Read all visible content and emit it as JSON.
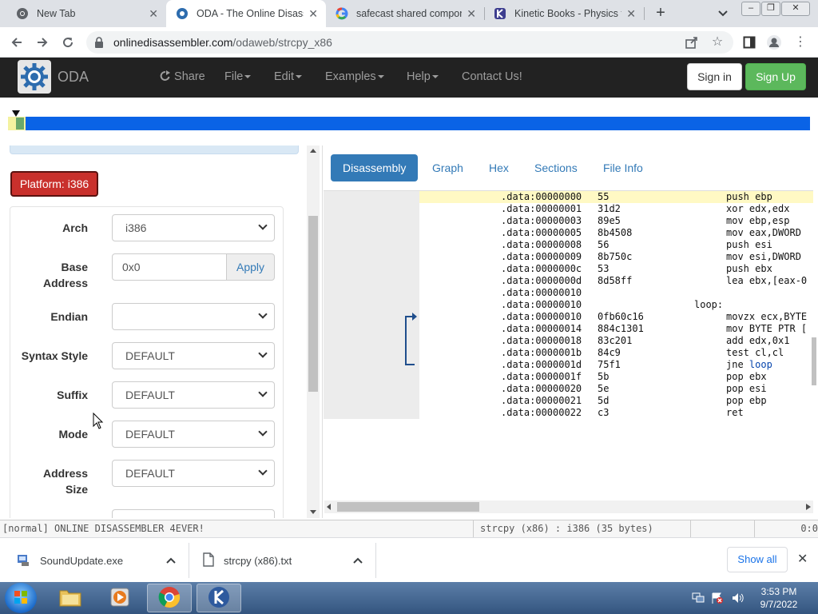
{
  "browser": {
    "tabs": [
      {
        "title": "New Tab",
        "icon": "chrome-icon"
      },
      {
        "title": "ODA - The Online Disasse",
        "icon": "oda-gear-icon"
      },
      {
        "title": "safecast shared compone",
        "icon": "google-icon"
      },
      {
        "title": "Kinetic Books - Physics fo",
        "icon": "kinetic-books-icon"
      }
    ],
    "url_host": "onlinedisassembler.com",
    "url_path": "/odaweb/strcpy_x86"
  },
  "oda": {
    "brand": "ODA",
    "menu": [
      {
        "label": "Share",
        "has_caret": false
      },
      {
        "label": "File",
        "has_caret": true
      },
      {
        "label": "Edit",
        "has_caret": true
      },
      {
        "label": "Examples",
        "has_caret": true
      },
      {
        "label": "Help",
        "has_caret": true
      },
      {
        "label": "Contact Us!",
        "has_caret": false
      }
    ],
    "sign_in": "Sign in",
    "sign_up": "Sign Up",
    "colors": {
      "navbar": "#222222",
      "primary": "#337ab7",
      "danger": "#c9302c",
      "success": "#5cb85c"
    }
  },
  "platform": {
    "label": "Platform: i386"
  },
  "form": {
    "arch": {
      "label": "Arch",
      "value": "i386"
    },
    "base_address": {
      "label_line1": "Base",
      "label_line2": "Address",
      "value": "0x0",
      "apply": "Apply"
    },
    "endian": {
      "label": "Endian",
      "value": ""
    },
    "syntax_style": {
      "label": "Syntax Style",
      "value": "DEFAULT"
    },
    "suffix": {
      "label": "Suffix",
      "value": "DEFAULT"
    },
    "mode": {
      "label": "Mode",
      "value": "DEFAULT"
    },
    "address_size": {
      "label_line1": "Address",
      "label_line2": "Size",
      "value": "DEFAULT"
    }
  },
  "right_tabs": [
    {
      "label": "Disassembly",
      "active": true
    },
    {
      "label": "Graph",
      "active": false
    },
    {
      "label": "Hex",
      "active": false
    },
    {
      "label": "Sections",
      "active": false
    },
    {
      "label": "File Info",
      "active": false
    }
  ],
  "disassembly": [
    {
      "addr": ".data:00000000",
      "bytes": "55",
      "ins": "push ebp"
    },
    {
      "addr": ".data:00000001",
      "bytes": "31d2",
      "ins": "xor edx,edx"
    },
    {
      "addr": ".data:00000003",
      "bytes": "89e5",
      "ins": "mov ebp,esp"
    },
    {
      "addr": ".data:00000005",
      "bytes": "8b4508",
      "ins": "mov eax,DWORD"
    },
    {
      "addr": ".data:00000008",
      "bytes": "56",
      "ins": "push esi"
    },
    {
      "addr": ".data:00000009",
      "bytes": "8b750c",
      "ins": "mov esi,DWORD"
    },
    {
      "addr": ".data:0000000c",
      "bytes": "53",
      "ins": "push ebx"
    },
    {
      "addr": ".data:0000000d",
      "bytes": "8d58ff",
      "ins": "lea ebx,[eax-0"
    },
    {
      "addr": ".data:00000010",
      "bytes": "",
      "ins": ""
    },
    {
      "addr": ".data:00000010",
      "bytes": "",
      "ins": "",
      "label": "loop:"
    },
    {
      "addr": ".data:00000010",
      "bytes": "0fb60c16",
      "ins": "movzx ecx,BYTE"
    },
    {
      "addr": ".data:00000014",
      "bytes": "884c1301",
      "ins": "mov BYTE PTR ["
    },
    {
      "addr": ".data:00000018",
      "bytes": "83c201",
      "ins": "add edx,0x1"
    },
    {
      "addr": ".data:0000001b",
      "bytes": "84c9",
      "ins": "test cl,cl"
    },
    {
      "addr": ".data:0000001d",
      "bytes": "75f1",
      "ins": "jne ",
      "target": "loop"
    },
    {
      "addr": ".data:0000001f",
      "bytes": "5b",
      "ins": "pop ebx"
    },
    {
      "addr": ".data:00000020",
      "bytes": "5e",
      "ins": "pop esi"
    },
    {
      "addr": ".data:00000021",
      "bytes": "5d",
      "ins": "pop ebp"
    },
    {
      "addr": ".data:00000022",
      "bytes": "c3",
      "ins": "ret"
    }
  ],
  "status": {
    "message": "[normal] ONLINE DISASSEMBLER 4EVER!",
    "file_info": "strcpy (x86) : i386 (35 bytes)",
    "position": "0:0"
  },
  "downloads": [
    {
      "name": "SoundUpdate.exe",
      "icon": "installer-icon"
    },
    {
      "name": "strcpy (x86).txt",
      "icon": "text-file-icon"
    }
  ],
  "show_all": "Show all",
  "taskbar": {
    "time": "3:53 PM",
    "date": "9/7/2022"
  }
}
